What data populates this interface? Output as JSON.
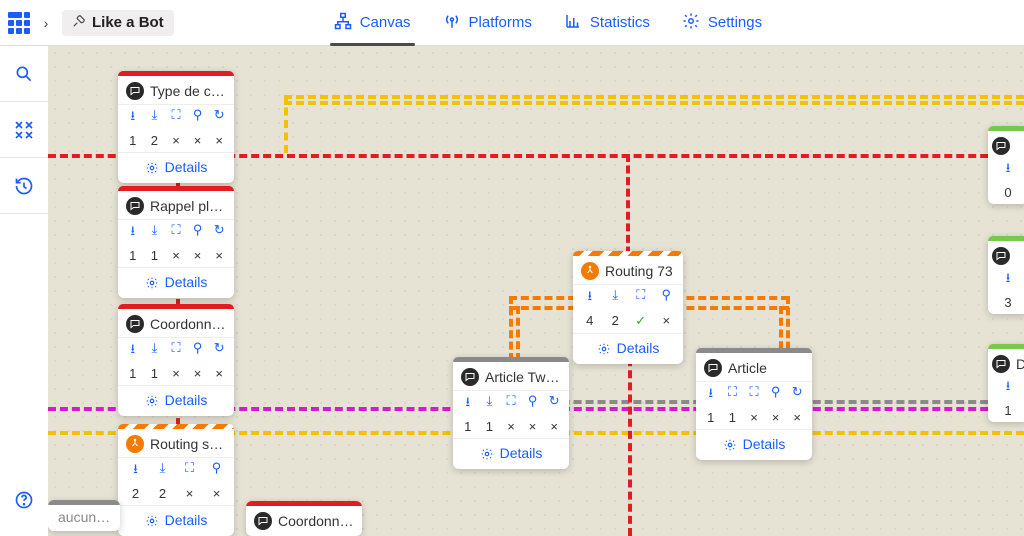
{
  "header": {
    "bot_name": "Like a Bot",
    "tools_icon": "tools-icon",
    "tabs": [
      {
        "id": "canvas",
        "label": "Canvas",
        "active": true
      },
      {
        "id": "platforms",
        "label": "Platforms",
        "active": false
      },
      {
        "id": "statistics",
        "label": "Statistics",
        "active": false
      },
      {
        "id": "settings",
        "label": "Settings",
        "active": false
      }
    ]
  },
  "left_rail": [
    {
      "id": "search",
      "name": "search-icon"
    },
    {
      "id": "collapse",
      "name": "collapse-icon"
    },
    {
      "id": "history",
      "name": "history-icon"
    }
  ],
  "left_rail_bottom": {
    "id": "help",
    "name": "help-icon"
  },
  "details_label": "Details",
  "nodes": {
    "n1": {
      "title": "Type de cont…",
      "type": "msg",
      "stripe": "red",
      "vals": [
        "1",
        "2",
        "×",
        "×",
        "×"
      ]
    },
    "n2": {
      "title": "Rappel plus t…",
      "type": "msg",
      "stripe": "red",
      "vals": [
        "1",
        "1",
        "×",
        "×",
        "×"
      ]
    },
    "n3": {
      "title": "Coordonnée …",
      "type": "msg",
      "stripe": "red",
      "vals": [
        "1",
        "1",
        "×",
        "×",
        "×"
      ]
    },
    "n4": {
      "title": "Routing saisi…",
      "type": "route",
      "stripe": "orange",
      "vals": [
        "2",
        "2",
        "×",
        "×"
      ]
    },
    "n5": {
      "title": "Coordonnées…",
      "type": "msg",
      "stripe": "red",
      "vals": []
    },
    "n6": {
      "title": "Article Twitter",
      "type": "msg",
      "stripe": "gray",
      "vals": [
        "1",
        "1",
        "×",
        "×",
        "×"
      ]
    },
    "n7": {
      "title": "Routing 73",
      "type": "route",
      "stripe": "orange",
      "vals": [
        "4",
        "2",
        "✓",
        "×"
      ]
    },
    "n8": {
      "title": "Article",
      "type": "msg",
      "stripe": "gray",
      "vals": [
        "1",
        "1",
        "×",
        "×",
        "×"
      ]
    },
    "n9": {
      "title": "",
      "type": "msg",
      "stripe": "green",
      "vals": [
        "0"
      ]
    },
    "n10": {
      "title": "",
      "type": "msg",
      "stripe": "green",
      "vals": [
        "3"
      ]
    },
    "n11": {
      "title": "D",
      "type": "msg",
      "stripe": "green",
      "vals": [
        "1"
      ]
    }
  },
  "fragment": {
    "text": "aucun…"
  }
}
